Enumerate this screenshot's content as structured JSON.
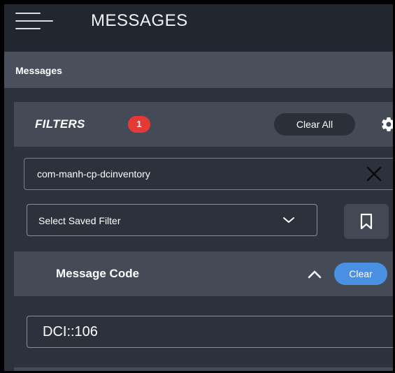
{
  "header": {
    "title": "MESSAGES",
    "menu_icon": "hamburger-menu-icon"
  },
  "breadcrumb": {
    "current": "Messages"
  },
  "filters": {
    "title": "FILTERS",
    "active_count": "1",
    "clear_all_label": "Clear All",
    "settings_icon": "gear-icon",
    "source_value": "com-manh-cp-dcinventory",
    "source_clear_icon": "close-icon",
    "saved_filter_placeholder": "Select Saved Filter",
    "saved_filter_icon": "chevron-down-icon",
    "bookmark_icon": "bookmark-icon"
  },
  "message_code": {
    "title": "Message Code",
    "collapse_icon": "chevron-up-icon",
    "clear_label": "Clear",
    "value": "DCI::106"
  },
  "colors": {
    "app_bg": "#2c313b",
    "topbar_bg": "#22262e",
    "section_bg": "#454a57",
    "badge_red": "#e53935",
    "accent_blue": "#4a90e2"
  }
}
